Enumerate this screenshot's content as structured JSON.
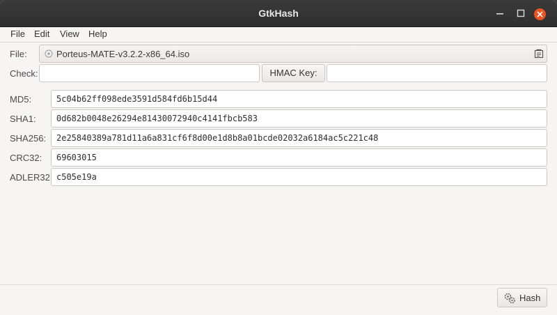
{
  "window": {
    "title": "GtkHash",
    "controls": [
      "minimize-icon",
      "maximize-icon",
      "close-icon"
    ]
  },
  "menu": {
    "items": [
      "File",
      "Edit",
      "View",
      "Help"
    ]
  },
  "file": {
    "label": "File:",
    "value": "Porteus-MATE-v3.2.2-x86_64.iso",
    "file_icon": "iso-file-icon",
    "browse_icon": "file-chooser-icon"
  },
  "check": {
    "label": "Check:",
    "value": "",
    "hmac_button": "HMAC Key:",
    "hmac_value": ""
  },
  "hashes": [
    {
      "label": "MD5:",
      "value": "5c04b62ff098ede3591d584fd6b15d44"
    },
    {
      "label": "SHA1:",
      "value": "0d682b0048e26294e81430072940c4141fbcb583"
    },
    {
      "label": "SHA256:",
      "value": "2e25840389a781d11a6a831cf6f8d00e1d8b8a01bcde02032a6184ac5c221c48"
    },
    {
      "label": "CRC32:",
      "value": "69603015"
    },
    {
      "label": "ADLER32:",
      "value": "c505e19a"
    }
  ],
  "actions": {
    "hash_label": "Hash",
    "hash_icon": "gears-icon"
  },
  "colors": {
    "titlebar": "#2f2f2f",
    "close_button": "#e95420",
    "window_bg": "#f6f5f4"
  }
}
